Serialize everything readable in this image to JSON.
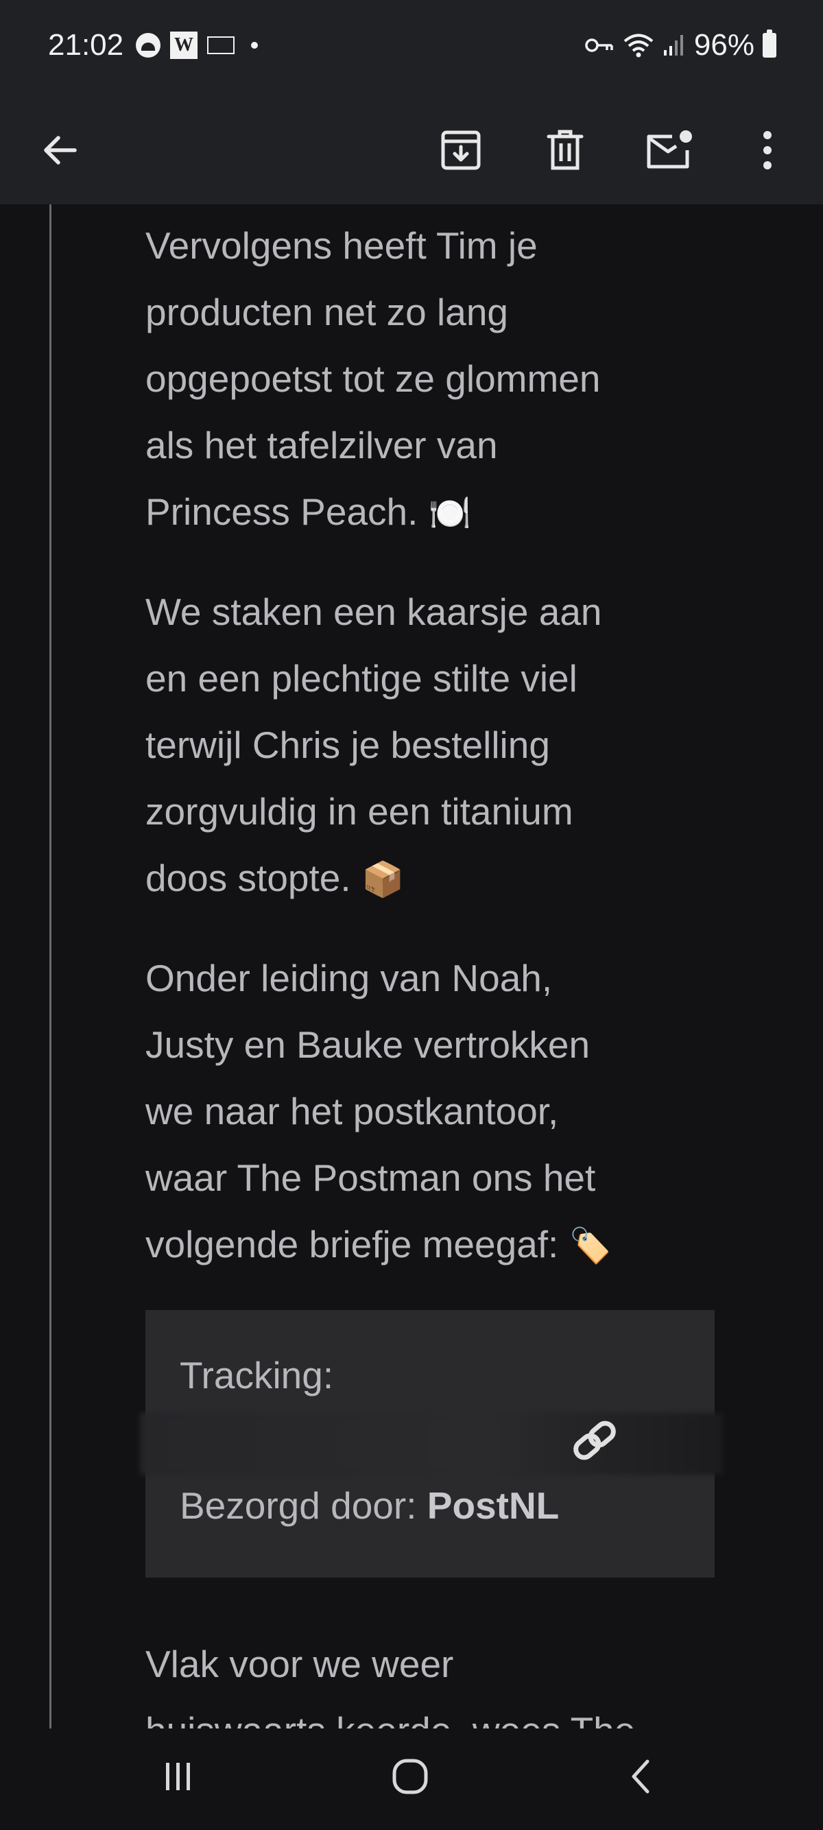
{
  "status_bar": {
    "time": "21:02",
    "battery": "96%",
    "left_icons": [
      "circle-app-icon",
      "w-app-icon",
      "news-app-icon",
      "notification-dot"
    ],
    "right_icons": [
      "vpn-key-icon",
      "wifi-icon",
      "signal-icon",
      "battery-icon"
    ]
  },
  "toolbar": {
    "icons": [
      "back-arrow-icon",
      "archive-icon",
      "delete-icon",
      "mark-unread-icon",
      "more-vert-icon"
    ]
  },
  "email": {
    "paragraphs": [
      {
        "lines": [
          "Vervolgens heeft Tim je",
          "producten net zo lang",
          "opgepoetst tot ze glommen",
          "als het tafelzilver van",
          "Princess Peach."
        ],
        "emoji": "🍽️"
      },
      {
        "lines": [
          "We staken een kaarsje aan",
          "en een plechtige stilte viel",
          "terwijl Chris je bestelling",
          "zorgvuldig in een titanium",
          "doos stopte."
        ],
        "emoji": "📦"
      },
      {
        "lines": [
          "Onder leiding van Noah,",
          "Justy en Bauke vertrokken",
          "we naar het postkantoor,",
          "waar The Postman ons het",
          "volgende briefje meegaf:"
        ],
        "emoji": "🏷️"
      },
      {
        "lines": [
          "Vlak voor we weer",
          "huiswaarts keerde, wees The"
        ]
      }
    ],
    "tracking": {
      "label": "Tracking:",
      "delivered_by_label": "Bezorgd door:",
      "carrier": "PostNL"
    }
  },
  "nav_bar": {
    "icons": [
      "recents-icon",
      "home-icon",
      "back-icon"
    ]
  },
  "colors": {
    "background": "#121214",
    "bar": "#202124",
    "text": "#b8b8bc",
    "tracking_box": "#2a2a2d"
  }
}
